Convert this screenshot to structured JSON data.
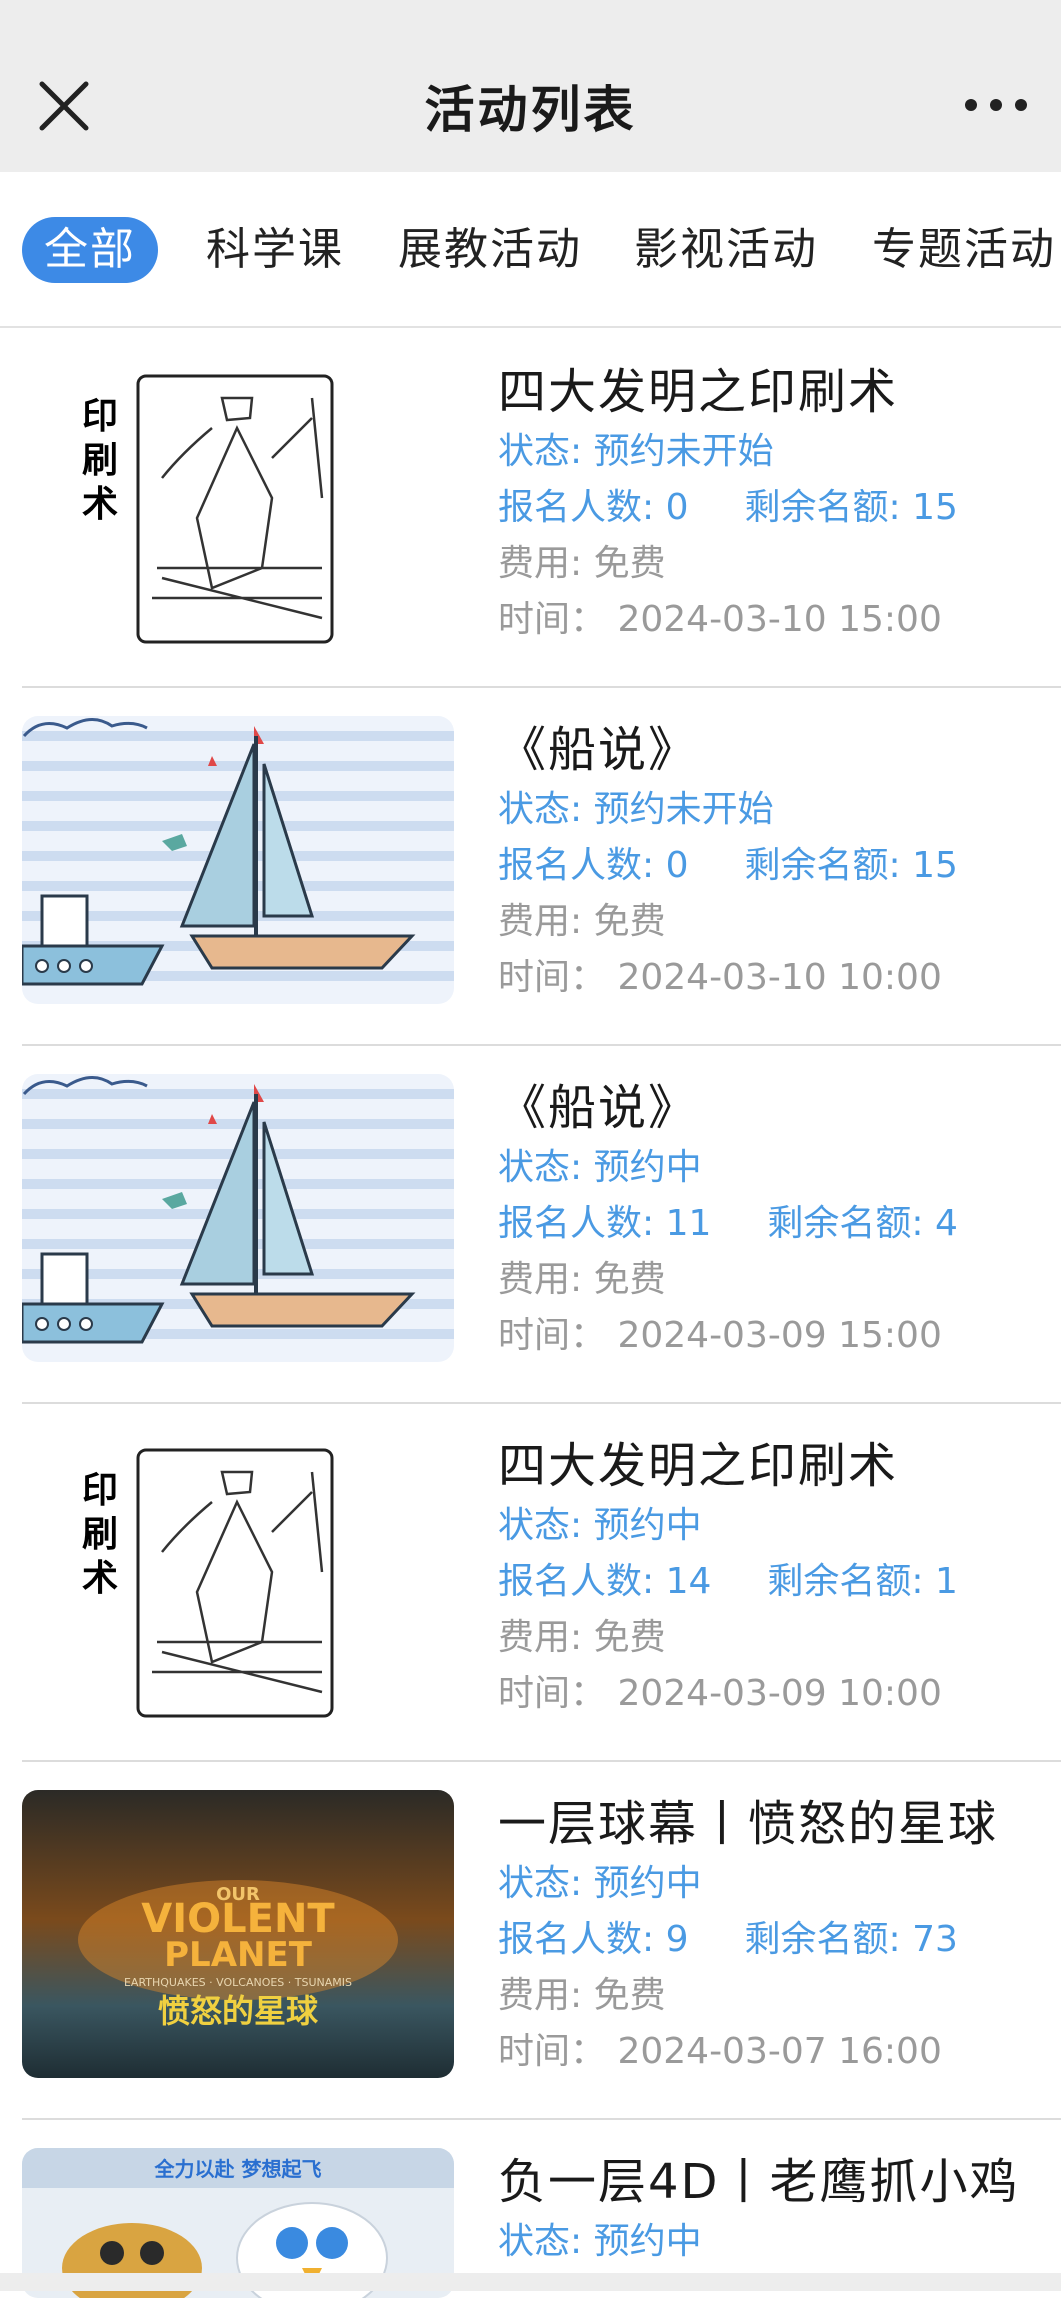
{
  "header": {
    "title": "活动列表"
  },
  "tabs": [
    {
      "label": "全部",
      "active": true
    },
    {
      "label": "科学课",
      "active": false
    },
    {
      "label": "展教活动",
      "active": false
    },
    {
      "label": "影视活动",
      "active": false
    },
    {
      "label": "专题活动",
      "active": false
    }
  ],
  "labels": {
    "status": "状态: ",
    "registered": "报名人数: ",
    "remaining": "剩余名额: ",
    "fee": "费用: ",
    "time": "时间： "
  },
  "items": [
    {
      "title": "四大发明之印刷术",
      "status": "预约未开始",
      "registered": "0",
      "remaining": "15",
      "fee": "免费",
      "time": "2024-03-10 15:00",
      "image": "printing-illustration"
    },
    {
      "title": "《船说》",
      "status": "预约未开始",
      "registered": "0",
      "remaining": "15",
      "fee": "免费",
      "time": "2024-03-10 10:00",
      "image": "sailboat-illustration"
    },
    {
      "title": "《船说》",
      "status": "预约中",
      "registered": "11",
      "remaining": "4",
      "fee": "免费",
      "time": "2024-03-09 15:00",
      "image": "sailboat-illustration"
    },
    {
      "title": "四大发明之印刷术",
      "status": "预约中",
      "registered": "14",
      "remaining": "1",
      "fee": "免费",
      "time": "2024-03-09 10:00",
      "image": "printing-illustration"
    },
    {
      "title": "一层球幕丨愤怒的星球",
      "status": "预约中",
      "registered": "9",
      "remaining": "73",
      "fee": "免费",
      "time": "2024-03-07 16:00",
      "image": "violent-planet-poster",
      "poster": {
        "line1": "OUR",
        "line2": "VIOLENT",
        "line3": "PLANET",
        "sub": "EARTHQUAKES · VOLCANOES · TSUNAMIS",
        "cn": "愤怒的星球"
      }
    },
    {
      "title": "负一层4D丨老鹰抓小鸡",
      "status": "预约中",
      "image": "eagle-poster",
      "poster": {
        "slogan": "全力以赴 梦想起飞"
      }
    }
  ],
  "thumb_text": {
    "printing": "印刷术"
  },
  "colors": {
    "accent": "#3d8ae6",
    "blue_text": "#4a9ae3",
    "gray_text": "#9a9a9a",
    "header_bg": "#ededed"
  }
}
